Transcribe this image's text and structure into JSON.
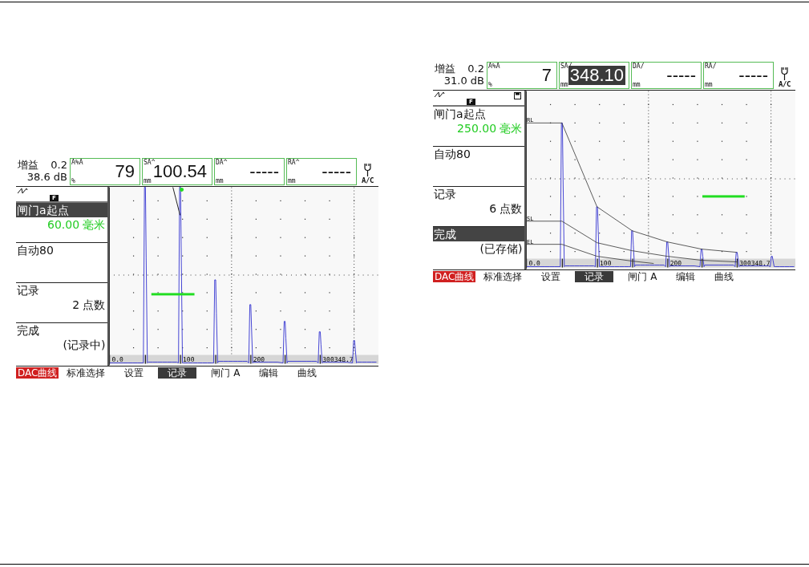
{
  "screens": [
    {
      "kind": "recording",
      "gain": {
        "label": "增益",
        "step": "0.2",
        "value": "38.6 dB"
      },
      "readings": [
        {
          "label": "A%A",
          "unit": "%",
          "value": "79",
          "selected": false
        },
        {
          "label": "SA^",
          "unit": "mm",
          "value": "100.54",
          "selected": false
        },
        {
          "label": "DA^",
          "unit": "mm",
          "value": "-----",
          "selected": false
        },
        {
          "label": "RA^",
          "unit": "mm",
          "value": "-----",
          "selected": false
        }
      ],
      "power": {
        "label": "A/C"
      },
      "mode_badge": "F",
      "menu": [
        {
          "title": "闸门a起点",
          "value": "60.00 毫米",
          "selected": true
        },
        {
          "title": "自动80",
          "selected": false
        },
        {
          "title": "记录",
          "value": "2 点数",
          "selected": false
        },
        {
          "title": "完成",
          "value": "(记录中)",
          "selected": false
        }
      ],
      "scale": [
        "0.0",
        "100",
        "200",
        "300348.7"
      ],
      "mode_title": "DAC曲线",
      "softkeys": [
        {
          "label": "标准选择",
          "selected": false
        },
        {
          "label": "设置",
          "selected": false
        },
        {
          "label": "记录",
          "selected": true
        },
        {
          "label": "闸门 A",
          "selected": false
        },
        {
          "label": "编辑",
          "selected": false
        },
        {
          "label": "曲线",
          "selected": false
        }
      ]
    },
    {
      "kind": "stored",
      "gain": {
        "label": "增益",
        "step": "0.2",
        "value": "31.0 dB"
      },
      "readings": [
        {
          "label": "A%A",
          "unit": "%",
          "value": "7",
          "selected": false
        },
        {
          "label": "SA/",
          "unit": "mm",
          "value": "348.10",
          "selected": true
        },
        {
          "label": "DA/",
          "unit": "mm",
          "value": "-----",
          "selected": false
        },
        {
          "label": "RA/",
          "unit": "mm",
          "value": "-----",
          "selected": false
        }
      ],
      "power": {
        "label": "A/C"
      },
      "mode_badge": "F",
      "saved": true,
      "menu": [
        {
          "title": "闸门a起点",
          "value": "250.00 毫米",
          "selected": false
        },
        {
          "title": "自动80",
          "selected": false
        },
        {
          "title": "记录",
          "value": "6 点数",
          "selected": false
        },
        {
          "title": "完成",
          "value": "(已存储)",
          "selected": true
        }
      ],
      "scale": [
        "0.0",
        "100",
        "200",
        "300348.7"
      ],
      "dac_curves": [
        {
          "label": "RL"
        },
        {
          "label": "SL"
        },
        {
          "label": "EL"
        }
      ],
      "mode_title": "DAC曲线",
      "softkeys": [
        {
          "label": "标准选择",
          "selected": false
        },
        {
          "label": "设置",
          "selected": false
        },
        {
          "label": "记录",
          "selected": true
        },
        {
          "label": "闸门 A",
          "selected": false
        },
        {
          "label": "编辑",
          "selected": false
        },
        {
          "label": "曲线",
          "selected": false
        }
      ]
    }
  ]
}
